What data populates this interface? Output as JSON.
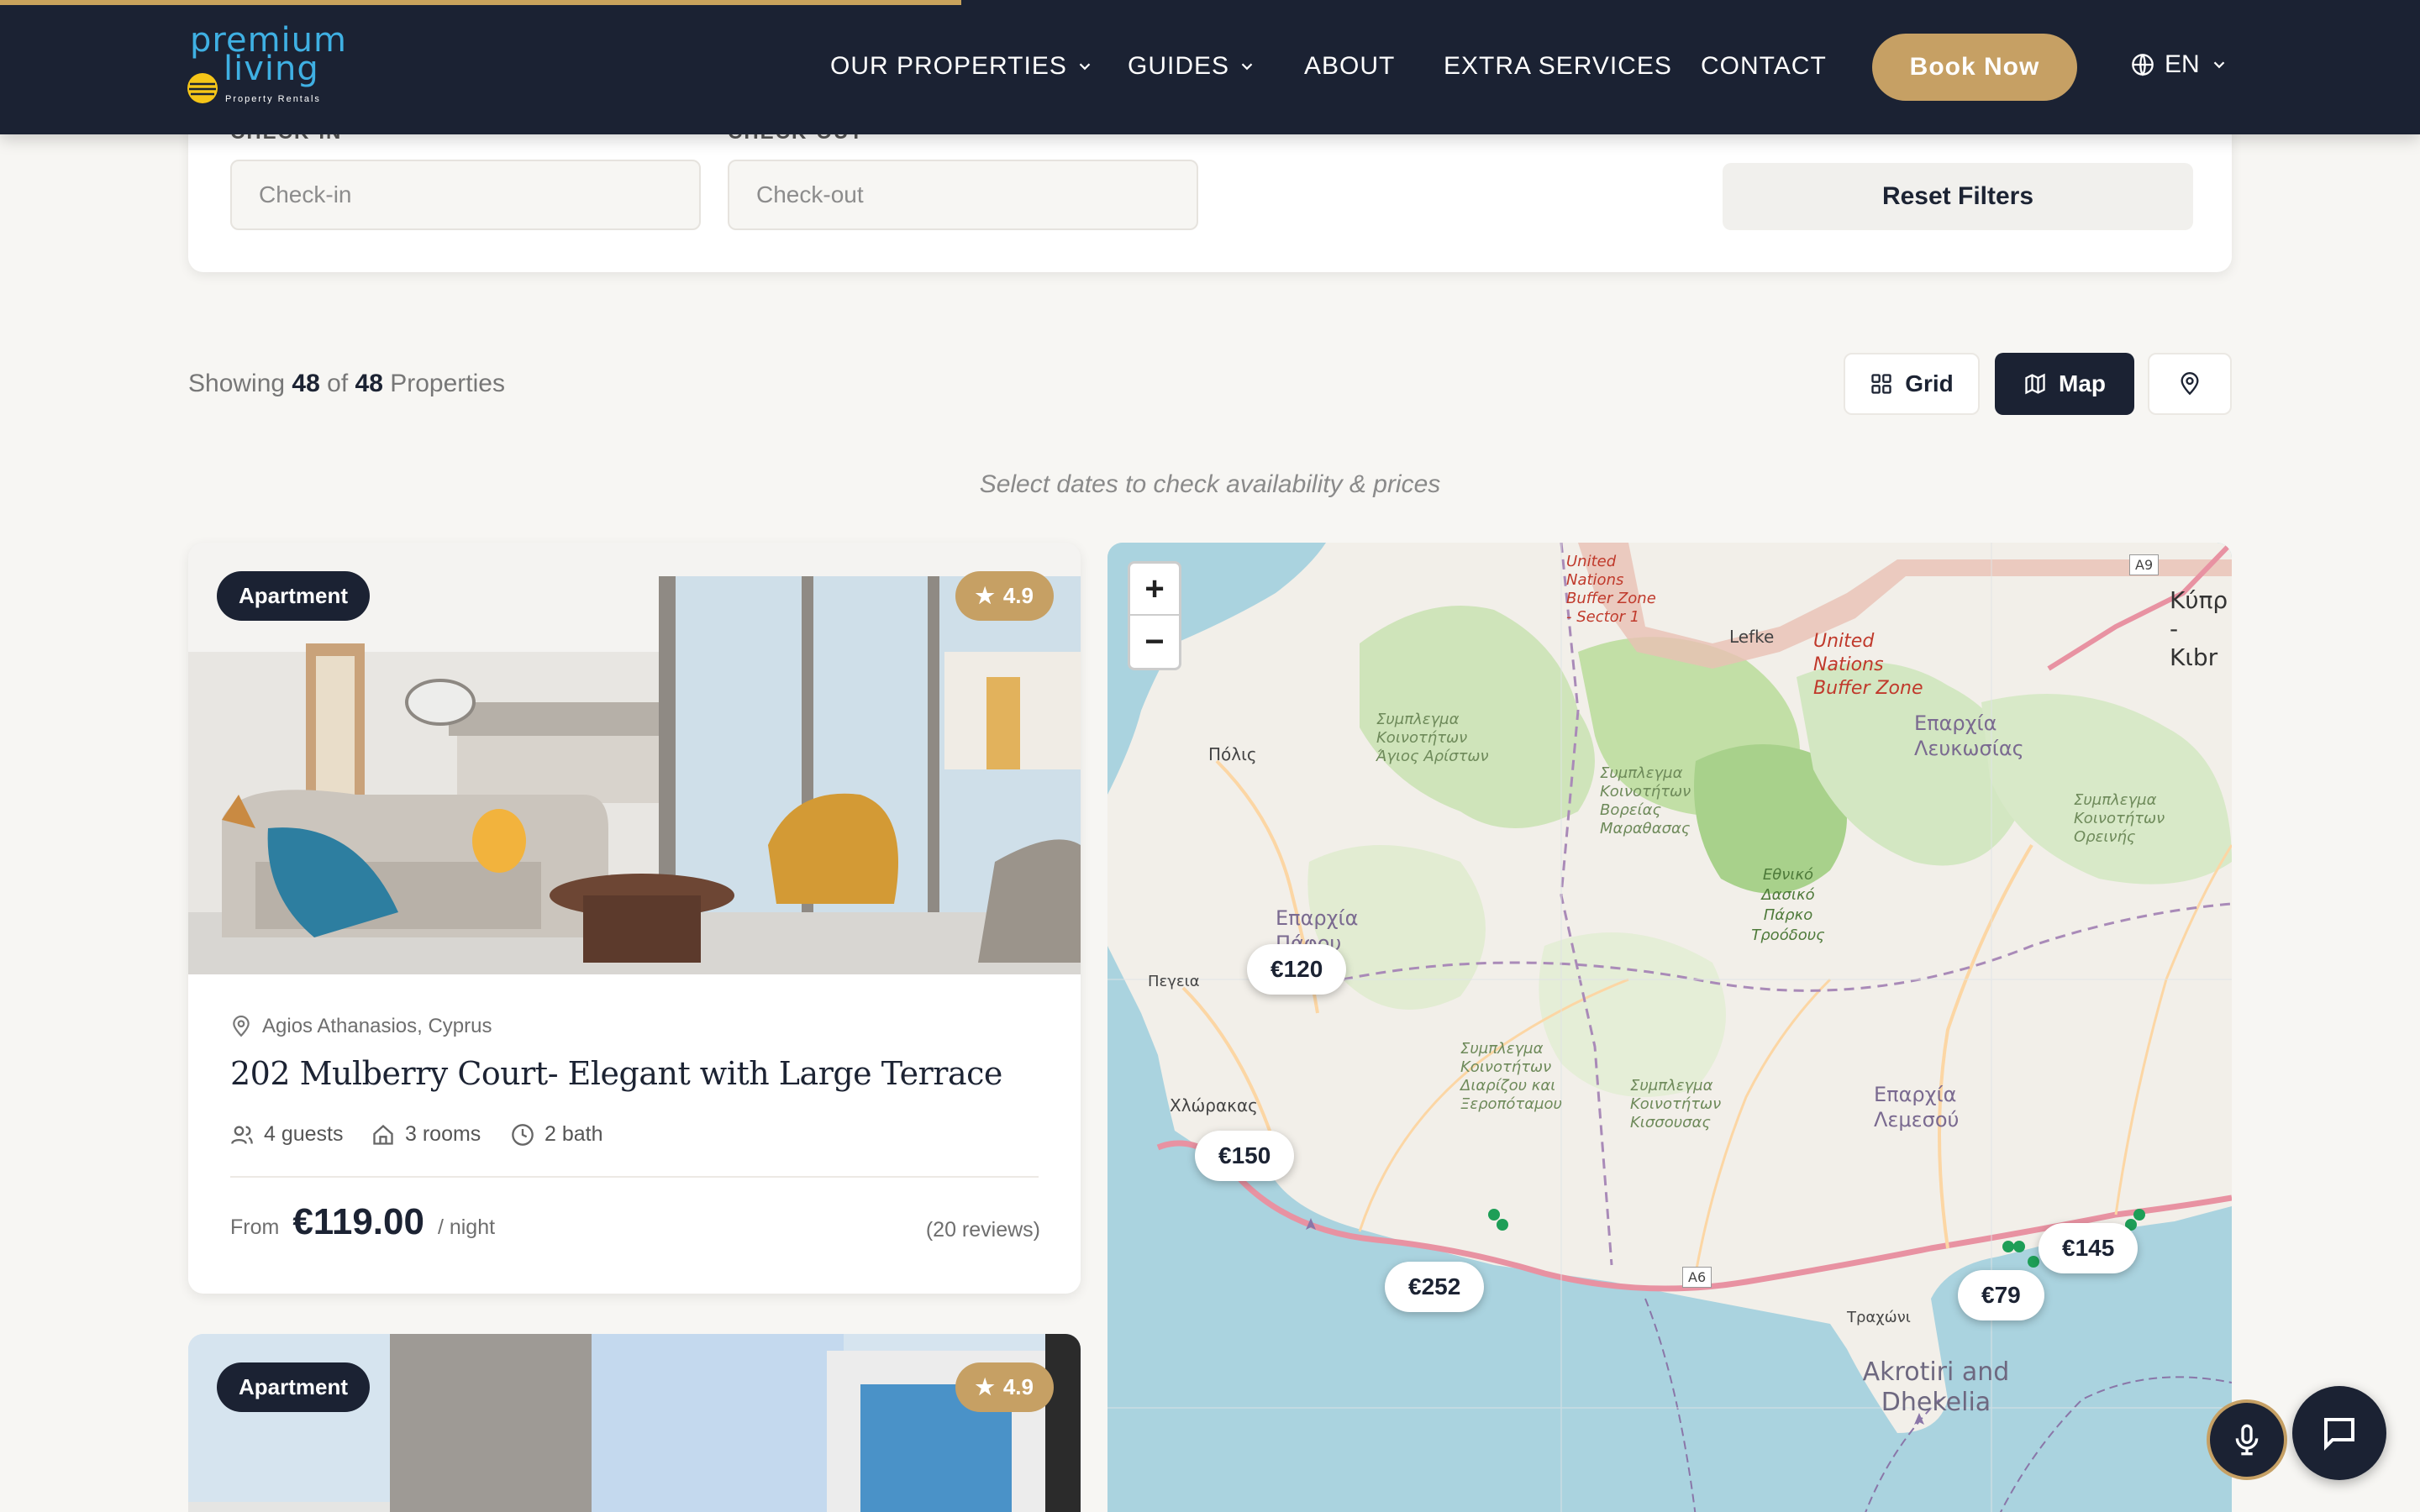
{
  "header": {
    "logo_line1": "premium",
    "logo_line2": "living",
    "logo_tagline": "Property Rentals",
    "nav": {
      "properties": "OUR PROPERTIES",
      "guides": "GUIDES",
      "about": "ABOUT",
      "extra_services": "EXTRA SERVICES",
      "contact": "CONTACT"
    },
    "book_label": "Book Now",
    "language": "EN",
    "icons": {
      "chevron": "chevron-down-icon",
      "globe": "globe-icon"
    }
  },
  "filters": {
    "checkin_label": "CHECK-IN",
    "checkin_placeholder": "Check-in",
    "checkout_label": "CHECK-OUT",
    "checkout_placeholder": "Check-out",
    "reset_label": "Reset Filters"
  },
  "results": {
    "showing_prefix": "Showing",
    "shown": "48",
    "of": "of",
    "total": "48",
    "suffix": "Properties",
    "hint": "Select dates to check availability & prices"
  },
  "view": {
    "grid_label": "Grid",
    "map_label": "Map",
    "active": "Map"
  },
  "properties": [
    {
      "type": "Apartment",
      "rating": "4.9",
      "location": "Agios Athanasios, Cyprus",
      "title": "202 Mulberry Court- Elegant with Large Terrace",
      "guests": "4 guests",
      "rooms": "3 rooms",
      "baths": "2 bath",
      "from_label": "From",
      "price": "€119.00",
      "per_night": "/ night",
      "reviews": "(20 reviews)"
    },
    {
      "type": "Apartment",
      "rating": "4.9"
    }
  ],
  "map": {
    "zoom_in": "+",
    "zoom_out": "−",
    "pins": [
      "€120",
      "€150",
      "€252",
      "€145",
      "€79"
    ],
    "labels": {
      "un_sector": "United Nations Buffer Zone - Sector 1",
      "lefke": "Lefke",
      "un_zone": "United Nations Buffer Zone",
      "kypros": "Κύπρ - Κιbr",
      "polis": "Πόλις",
      "agios_aristou": "Συμπλεγμα Κοινοτήτων Άγιος Αρίστων",
      "voreias_marathasas": "Συμπλεγμα Κοινοτήτων Βορείας Μαραθασας",
      "lefkosias": "Επαρχία Λευκωσίας",
      "oreinis": "Συμπλεγμα Κοινοτήτων Ορεινής",
      "pafou": "Επαρχία Πάφου",
      "pegeia": "Πεγεια",
      "troodos": "Εθνικό Δασικό Πάρκο Τροόδους",
      "diarizou": "Συμπλεγμα Κοινοτήτων Διαρίζου και Ξεροπόταμου",
      "kissousas": "Συμπλεγμα Κοινοτήτων Κισσουσας",
      "lemesou": "Επαρχία Λεμεσού",
      "chlorakas": "Χλώρακας",
      "trachoni": "Τραχώνι",
      "akrotiri": "Akrotiri and Dhekelia",
      "road_a6": "A6",
      "road_a9": "A9"
    }
  },
  "colors": {
    "navy": "#1b2233",
    "gold": "#c6a064",
    "logo_blue": "#3fb0e3",
    "sea": "#aad3df",
    "land": "#f2efe9"
  },
  "floating": {
    "mic": "microphone-icon",
    "chat": "chat-bubble-icon"
  }
}
